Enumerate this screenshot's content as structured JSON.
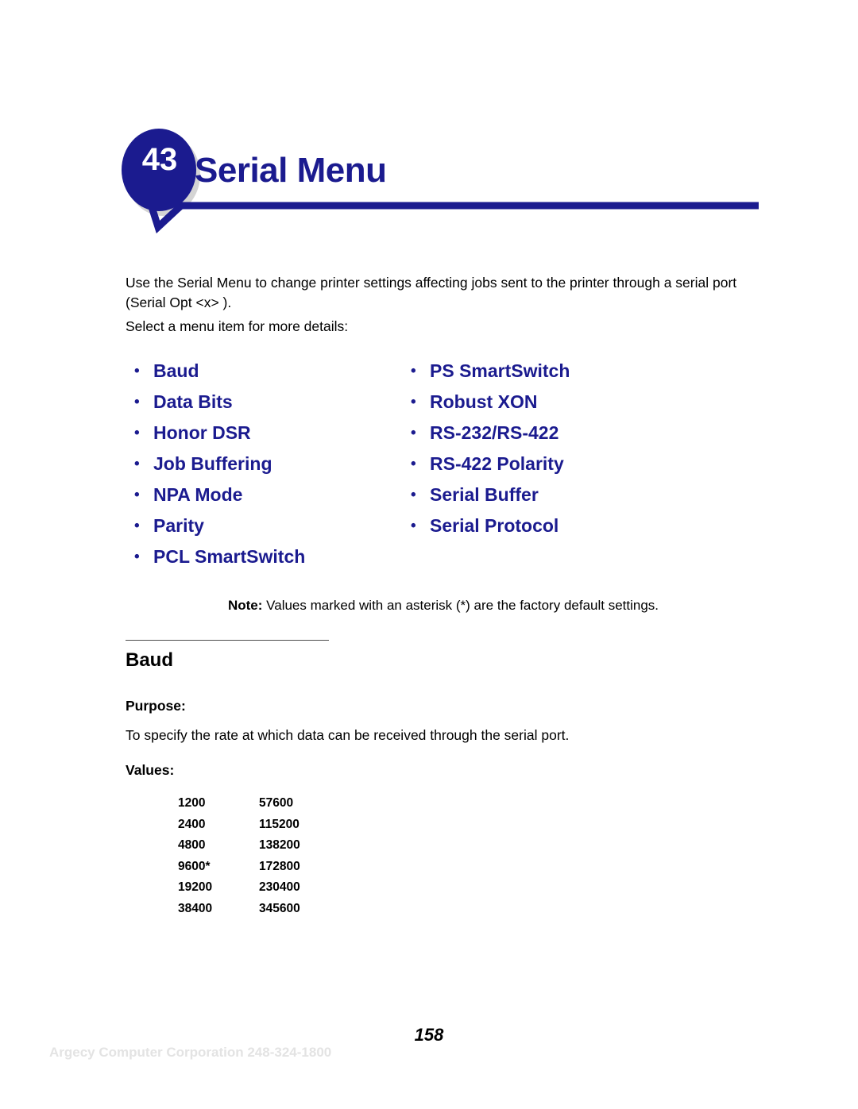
{
  "header": {
    "chapter_number": "43",
    "title": "Serial Menu",
    "badge_color": "#1b1b8f",
    "title_color": "#1b1b8f",
    "badge_shadow_color": "#d4d4d4"
  },
  "intro": {
    "paragraph_1": "Use the Serial Menu to change printer settings affecting jobs sent to the printer through a serial port (Serial Opt <x> ).",
    "paragraph_2": "Select a menu item for more details:"
  },
  "menu_links": {
    "bullet_glyph": "•",
    "link_color": "#1b1b8f",
    "left_column": [
      {
        "label": "Baud"
      },
      {
        "label": "Data Bits"
      },
      {
        "label": "Honor DSR"
      },
      {
        "label": "Job Buffering"
      },
      {
        "label": "NPA Mode"
      },
      {
        "label": "Parity"
      },
      {
        "label": "PCL SmartSwitch"
      }
    ],
    "right_column": [
      {
        "label": "PS SmartSwitch"
      },
      {
        "label": "Robust XON"
      },
      {
        "label": "RS-232/RS-422"
      },
      {
        "label": "RS-422 Polarity"
      },
      {
        "label": "Serial Buffer"
      },
      {
        "label": "Serial Protocol"
      }
    ]
  },
  "note": {
    "label": "Note:",
    "text": " Values marked with an asterisk (*) are the factory default settings."
  },
  "section": {
    "heading": "Baud",
    "purpose_label": "Purpose:",
    "purpose_text": "To specify the rate at which data can be received through the serial port.",
    "values_label": "Values:"
  },
  "values_table": {
    "rows": [
      {
        "col_a": "1200",
        "col_b": "57600"
      },
      {
        "col_a": "2400",
        "col_b": "115200"
      },
      {
        "col_a": "4800",
        "col_b": "138200"
      },
      {
        "col_a": "9600*",
        "col_b": "172800"
      },
      {
        "col_a": "19200",
        "col_b": "230400"
      },
      {
        "col_a": "38400",
        "col_b": "345600"
      }
    ]
  },
  "footer": {
    "page_number": "158",
    "watermark": "Argecy Computer Corporation 248-324-1800"
  }
}
